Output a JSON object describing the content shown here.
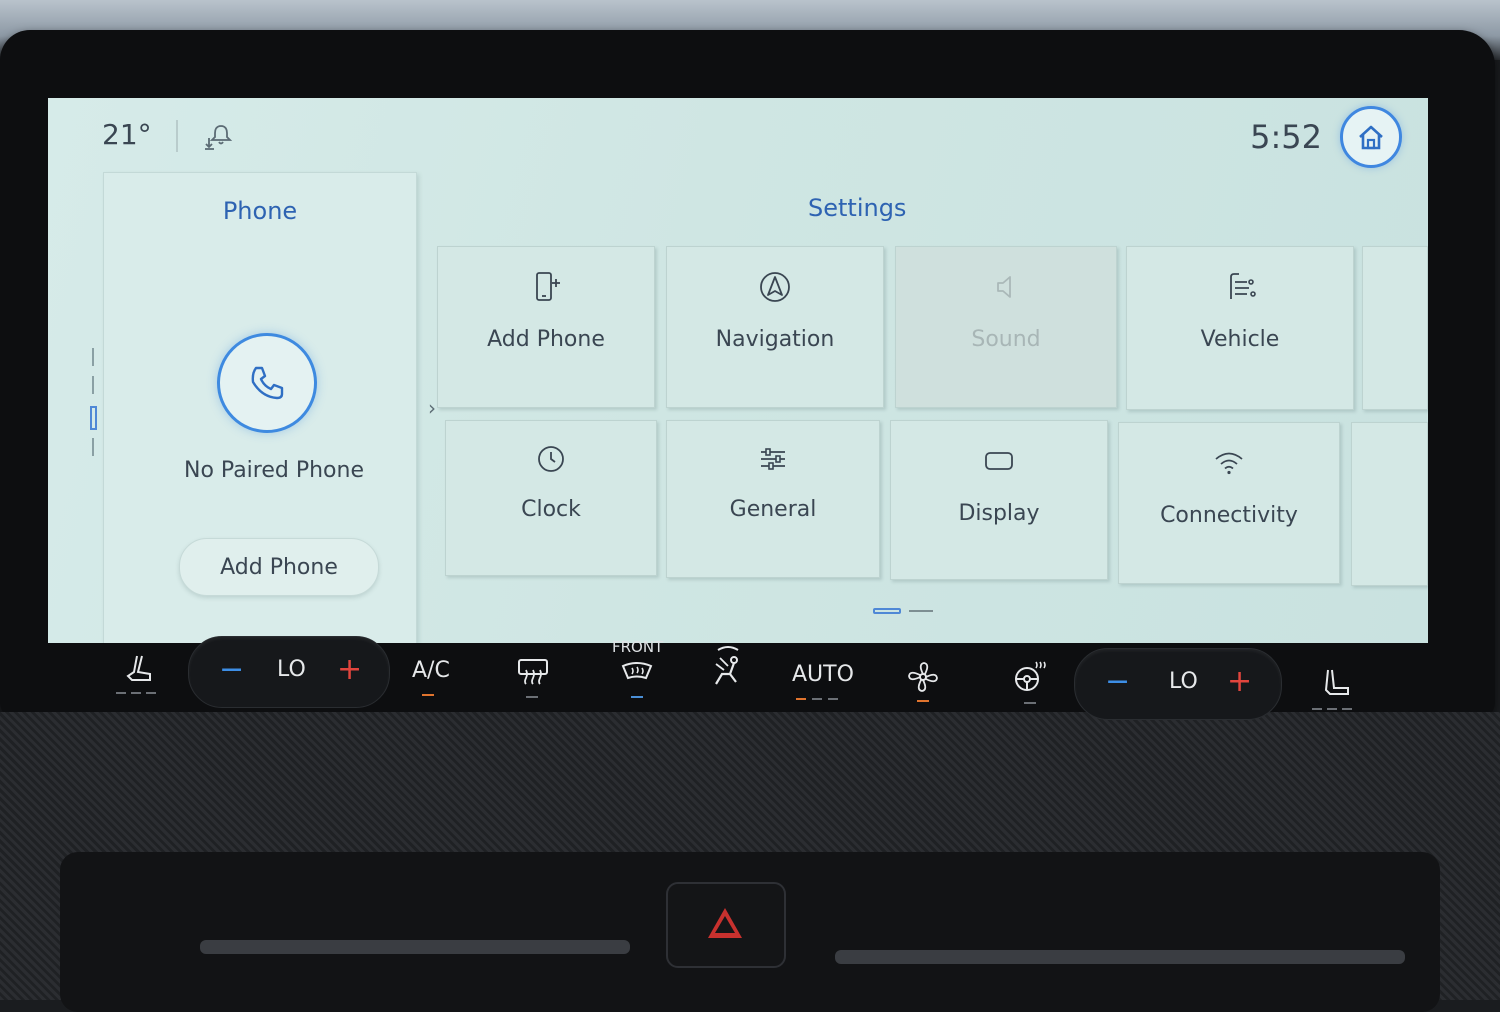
{
  "status": {
    "temperature": "21°",
    "clock": "5:52",
    "notification_icon": "notification-download-icon",
    "home_icon": "home-icon"
  },
  "phone_panel": {
    "title": "Phone",
    "status_text": "No Paired Phone",
    "add_button_label": "Add Phone",
    "call_icon": "phone-handset-icon"
  },
  "settings": {
    "title": "Settings",
    "tiles": [
      {
        "label": "Add Phone",
        "icon": "add-phone-icon"
      },
      {
        "label": "Navigation",
        "icon": "navigation-arrow-icon"
      },
      {
        "label": "Sound",
        "icon": "speaker-icon",
        "disabled": true
      },
      {
        "label": "Vehicle",
        "icon": "vehicle-settings-icon"
      },
      {
        "label": "Clock",
        "icon": "clock-icon"
      },
      {
        "label": "General",
        "icon": "sliders-icon"
      },
      {
        "label": "Display",
        "icon": "display-icon"
      },
      {
        "label": "Connectivity",
        "icon": "wifi-icon"
      }
    ]
  },
  "climate": {
    "driver_temp": "LO",
    "passenger_temp": "LO",
    "ac_label": "A/C",
    "front_label": "FRONT",
    "auto_label": "AUTO",
    "minus_symbol": "−",
    "plus_symbol": "+"
  },
  "colors": {
    "accent_blue": "#2e63b2",
    "ring_blue": "#3e8ae0",
    "climate_plus": "#e2453d",
    "climate_minus": "#3d8ee6",
    "indicator_orange": "#e0742e"
  }
}
